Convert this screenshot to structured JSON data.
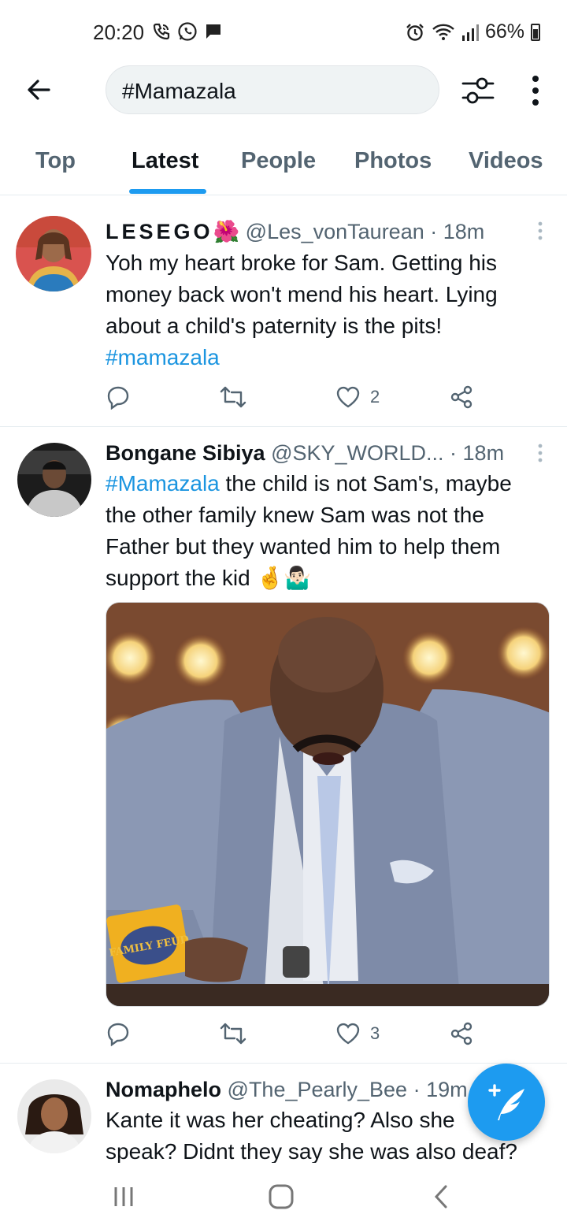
{
  "status_bar": {
    "time": "20:20",
    "battery": "66%",
    "left_icons": [
      "wifi-call-icon",
      "whatsapp-icon",
      "message-icon"
    ],
    "right_icons": [
      "alarm-icon",
      "wifi-icon",
      "signal-icon",
      "battery-icon"
    ]
  },
  "header": {
    "search_value": "#Mamazala",
    "icons": [
      "back-arrow-icon",
      "filter-sliders-icon",
      "more-vertical-icon"
    ]
  },
  "tabs": [
    {
      "label": "Top",
      "active": false
    },
    {
      "label": "Latest",
      "active": true
    },
    {
      "label": "People",
      "active": false
    },
    {
      "label": "Photos",
      "active": false
    },
    {
      "label": "Videos",
      "active": false
    }
  ],
  "tweets": [
    {
      "name": "LESEGO",
      "name_emoji": "🌺",
      "handle": "@Les_vonTaurean",
      "time": "· 18m",
      "lines": [
        "Yoh my heart broke for Sam. Getting his",
        "money back won't mend his heart. Lying",
        "about a child's paternity is the pits!"
      ],
      "hashtag": "#mamazala",
      "likes": "2"
    },
    {
      "name": "Bongane Sibiya",
      "handle": "@SKY_WORLD...",
      "time": "· 18m",
      "hashtag": "#Mamazala",
      "line1_rest": " the child is not Sam's, maybe",
      "lines": [
        "the other family knew Sam was not the",
        "Father but they wanted him to help them"
      ],
      "last_line": "support the kid",
      "emojis": "🤞🤷🏻‍♂️",
      "likes": "3",
      "media_card_text": "FAMILY FEUD"
    },
    {
      "name": "Nomaphelo",
      "handle": "@The_Pearly_Bee",
      "time": "· 19m",
      "lines": [
        "Kante it was her cheating? Also she",
        "speak? Didnt they say she was also deaf?"
      ]
    }
  ],
  "colors": {
    "accent": "#1d9bf0",
    "hashtag": "#1b95e0",
    "secondary_text": "#536471"
  }
}
